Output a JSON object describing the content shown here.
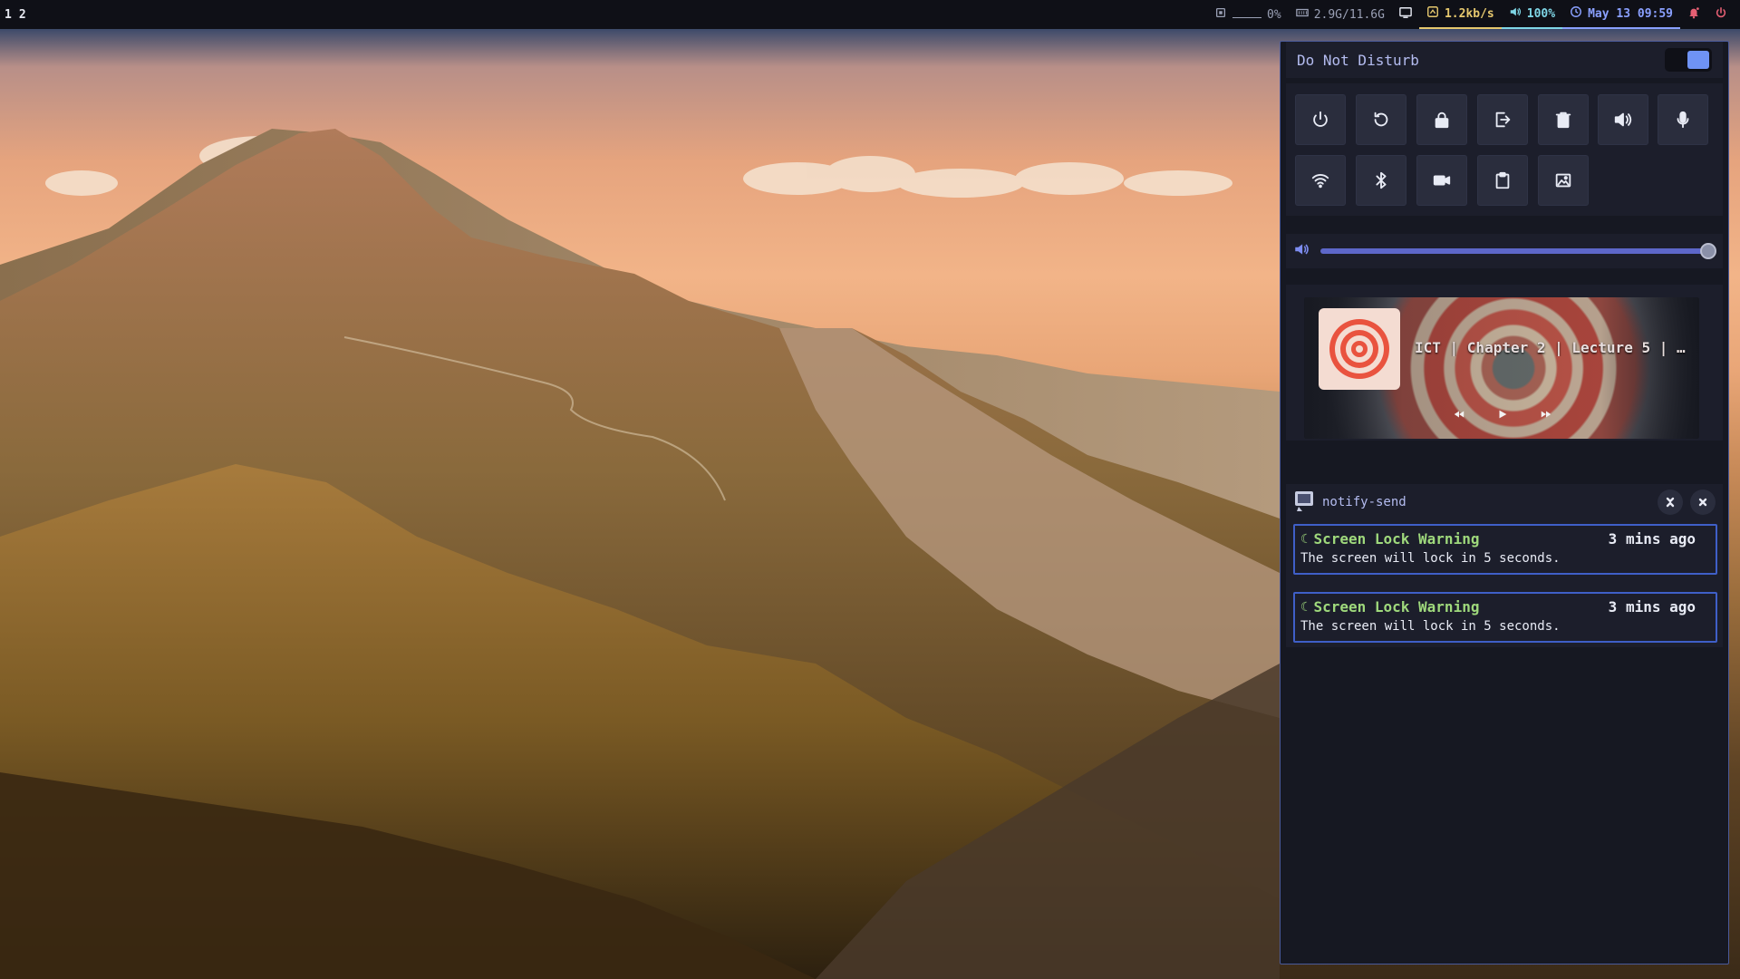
{
  "topbar": {
    "workspaces": [
      "1",
      "2"
    ],
    "cpu": "0%",
    "memory": "2.9G/11.6G",
    "network": "1.2kb/s",
    "volume": "100%",
    "clock": "May 13 09:59",
    "icons": [
      "cpu-icon",
      "memory-icon",
      "screen-icon",
      "network-icon",
      "volume-icon",
      "clock-icon",
      "bell-icon",
      "power-icon"
    ]
  },
  "control_center": {
    "dnd_label": "Do Not Disturb",
    "dnd_enabled": true,
    "buttons_row1": [
      "power-icon",
      "restart-icon",
      "lock-icon",
      "logout-icon",
      "trash-icon",
      "volume-icon",
      "microphone-icon"
    ],
    "buttons_row2": [
      "wifi-icon",
      "bluetooth-icon",
      "video-camera-icon",
      "clipboard-icon",
      "image-icon"
    ],
    "volume_level": 1.0,
    "media": {
      "title": "ICT | Chapter 2 | Lecture 5 | ...",
      "controls": [
        "previous-icon",
        "play-icon",
        "next-icon"
      ]
    },
    "notification_group": {
      "app": "notify-send",
      "notifications": [
        {
          "title": "Screen Lock Warning",
          "time": "3 mins ago",
          "body": "The screen will lock in 5 seconds."
        },
        {
          "title": "Screen Lock Warning",
          "time": "3 mins ago",
          "body": "The screen will lock in 5 seconds."
        }
      ]
    }
  },
  "colors": {
    "accent": "#6f93f5",
    "notif_title": "#9fd97c",
    "network": "#e6c86e",
    "volume": "#7fd6e6",
    "clock": "#8aa0ff",
    "alert": "#e55f73"
  }
}
